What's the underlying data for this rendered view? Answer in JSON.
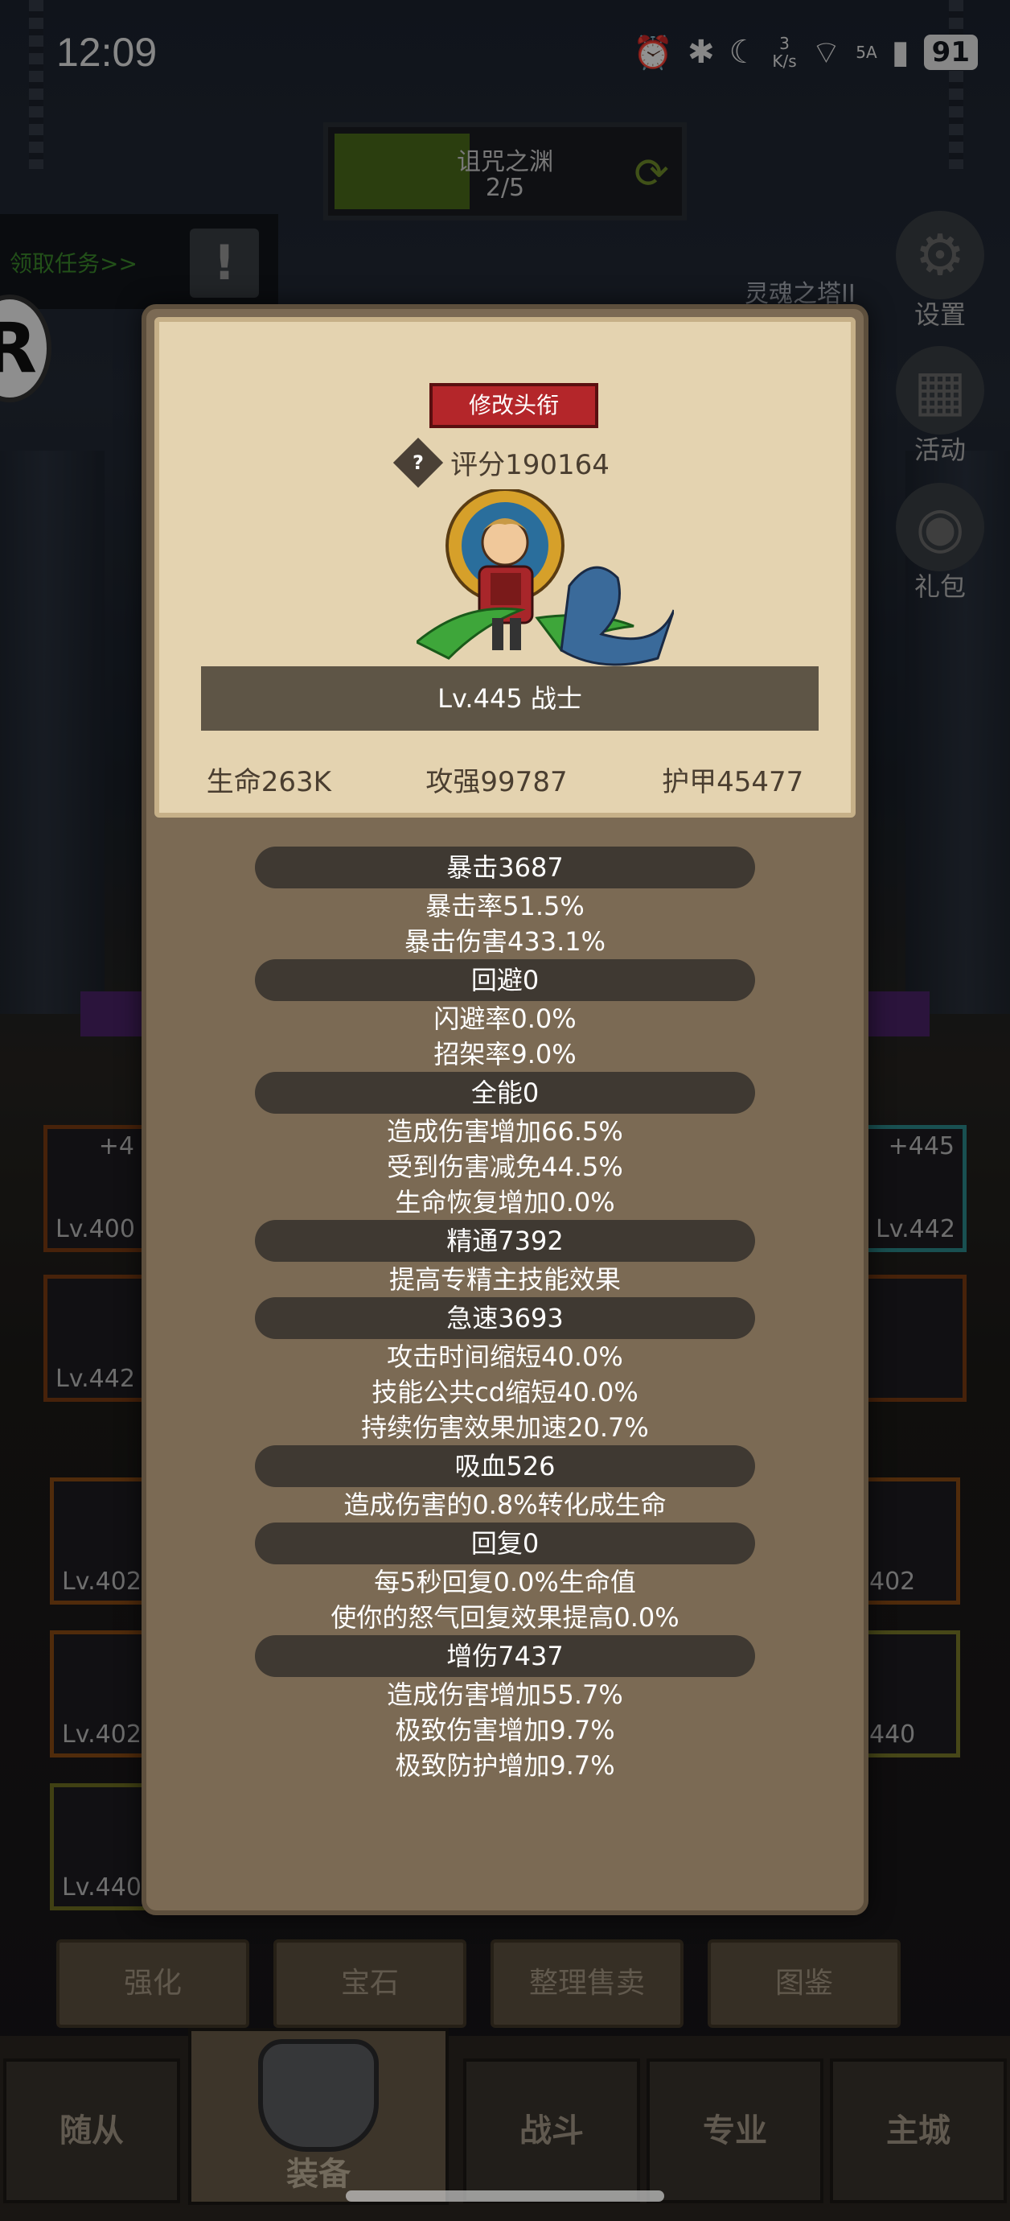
{
  "status_bar": {
    "time": "12:09",
    "net_speed_value": "3",
    "net_speed_unit": "K/s",
    "signal": "5A",
    "battery": "91"
  },
  "stage": {
    "name": "诅咒之渊",
    "progress": "2/5"
  },
  "quest": {
    "label": "领取任务>>"
  },
  "side_menu": {
    "tower": "灵魂之塔II",
    "settings": "设置",
    "activity": "活动",
    "gift": "礼包"
  },
  "equipment_slots": [
    {
      "level": "Lv.400",
      "plus": "+4"
    },
    {
      "level": "Lv.442",
      "plus": "+445"
    },
    {
      "level": "Lv.442",
      "plus": ""
    },
    {
      "level": "Lv.402",
      "plus": ""
    },
    {
      "level": "402",
      "plus": ""
    },
    {
      "level": "Lv.402",
      "plus": ""
    },
    {
      "level": "440",
      "plus": ""
    },
    {
      "level": "Lv.440",
      "plus": ""
    }
  ],
  "actions": {
    "enhance": "强化",
    "gem": "宝石",
    "sort_sell": "整理售卖",
    "codex": "图鉴"
  },
  "nav": {
    "follower": "随从",
    "equipment": "装备",
    "battle": "战斗",
    "profession": "专业",
    "city": "主城"
  },
  "colors": {
    "rename_button": "#b4262a",
    "panel_parchment": "#e4d3b0",
    "panel_body": "#7b6a54",
    "stage_fill": "#4a6b1a"
  },
  "modal": {
    "rename_button": "修改头衔",
    "score_icon": "?",
    "score": "评分190164",
    "level_class": "Lv.445 战士",
    "hp": "生命263K",
    "attack": "攻强99787",
    "armor": "护甲45477",
    "attributes": [
      {
        "title": "暴击3687",
        "lines": [
          "暴击率51.5%",
          "暴击伤害433.1%"
        ]
      },
      {
        "title": "回避0",
        "lines": [
          "闪避率0.0%",
          "招架率9.0%"
        ]
      },
      {
        "title": "全能0",
        "lines": [
          "造成伤害增加66.5%",
          "受到伤害减免44.5%",
          "生命恢复增加0.0%"
        ]
      },
      {
        "title": "精通7392",
        "lines": [
          "提高专精主技能效果"
        ]
      },
      {
        "title": "急速3693",
        "lines": [
          "攻击时间缩短40.0%",
          "技能公共cd缩短40.0%",
          "持续伤害效果加速20.7%"
        ]
      },
      {
        "title": "吸血526",
        "lines": [
          "造成伤害的0.8%转化成生命"
        ]
      },
      {
        "title": "回复0",
        "lines": [
          "每5秒回复0.0%生命值",
          "使你的怒气回复效果提高0.0%"
        ]
      },
      {
        "title": "增伤7437",
        "lines": [
          "造成伤害增加55.7%",
          "极致伤害增加9.7%",
          "极致防护增加9.7%"
        ]
      }
    ]
  }
}
